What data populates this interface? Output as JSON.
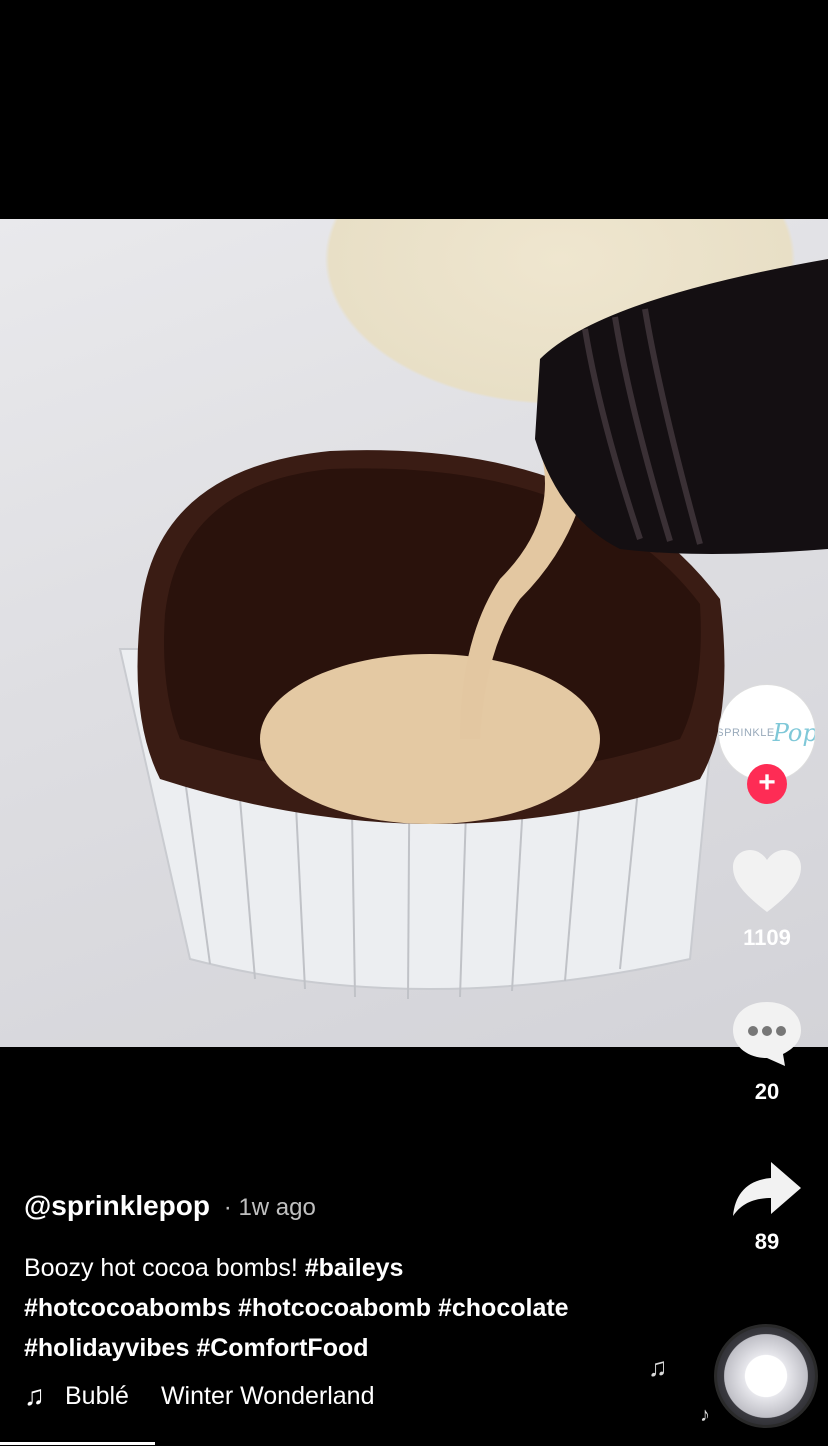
{
  "video": {
    "description_icon": "video-frame"
  },
  "creator": {
    "avatar_text": "SPRINKLE",
    "avatar_script": "Pop"
  },
  "actions": {
    "likes": "1109",
    "comments": "20",
    "shares": "89"
  },
  "post": {
    "username": "@sprinklepop",
    "time": "· 1w ago",
    "caption_text": "Boozy hot cocoa bombs!",
    "hashtags": [
      "#baileys",
      "#hotcocoabombs",
      "#hotcocoabomb",
      "#chocolate",
      "#holidayvibes",
      "#ComfortFood"
    ]
  },
  "music": {
    "artist": "Bublé",
    "title": "Winter Wonderland"
  },
  "colors": {
    "follow": "#fe2c55",
    "background": "#000000"
  }
}
